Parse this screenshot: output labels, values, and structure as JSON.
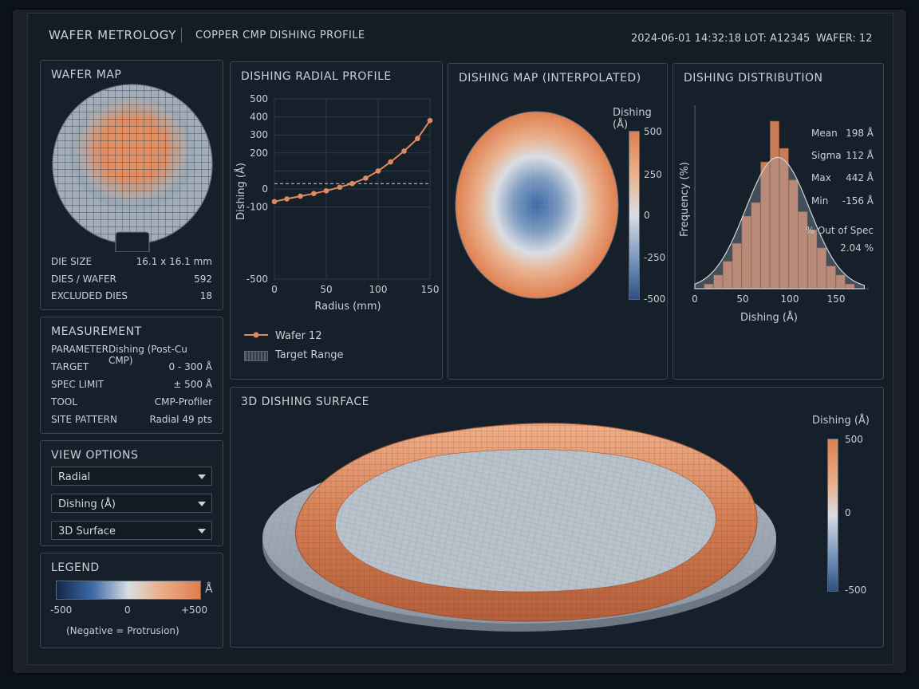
{
  "header": {
    "app_title": "WAFER METROLOGY",
    "subtitle": "COPPER CMP DISHING PROFILE",
    "datetime": "2024-06-01 14:32:18",
    "lot": "LOT: A12345",
    "wafer": "WAFER: 12"
  },
  "wafer_map": {
    "title": "WAFER MAP",
    "rows": [
      {
        "label": "DIE SIZE",
        "value": "16.1 x 16.1 mm"
      },
      {
        "label": "DIES / WAFER",
        "value": "592"
      },
      {
        "label": "EXCLUDED DIES",
        "value": "18"
      }
    ]
  },
  "measurement": {
    "title": "MEASUREMENT",
    "rows": [
      {
        "label": "PARAMETER",
        "value": "Dishing (Post-Cu CMP)"
      },
      {
        "label": "TARGET",
        "value": "0 - 300 Å"
      },
      {
        "label": "SPEC LIMIT",
        "value": "± 500 Å"
      },
      {
        "label": "TOOL",
        "value": "CMP-Profiler"
      },
      {
        "label": "SITE PATTERN",
        "value": "Radial 49 pts"
      }
    ]
  },
  "view_options": {
    "title": "VIEW OPTIONS",
    "selects": [
      "Radial",
      "Dishing (Å)",
      "3D Surface"
    ]
  },
  "legend": {
    "title": "LEGEND",
    "unit": "Å",
    "min": "-500",
    "mid": "0",
    "max": "+500",
    "note": "(Negative = Protrusion)"
  },
  "radial_profile": {
    "title": "DISHING RADIAL PROFILE",
    "legend_series": "Wafer 12",
    "legend_target": "Target Range"
  },
  "dishing_map": {
    "title": "DISHING MAP (INTERPOLATED)",
    "cbar_label": "Dishing (Å)",
    "cbar_ticks": [
      "500",
      "250",
      "0",
      "-250",
      "-500"
    ]
  },
  "distribution": {
    "title": "DISHING DISTRIBUTION",
    "stats": [
      {
        "label": "Mean",
        "value": "198 Å"
      },
      {
        "label": "Sigma",
        "value": "112 Å"
      },
      {
        "label": "Max",
        "value": "442 Å"
      },
      {
        "label": "Min",
        "value": "-156 Å"
      }
    ],
    "oos_label": "% Out of Spec",
    "oos_value": "2.04 %"
  },
  "surface3d": {
    "title": "3D DISHING SURFACE",
    "cbar_label": "Dishing (Å)",
    "cbar_ticks": [
      "500",
      "0",
      "-500"
    ]
  },
  "colors": {
    "accent": "#e08a5f",
    "cool": "#3d6aa6",
    "neutral": "#d9dde2"
  },
  "chart_data": [
    {
      "type": "line",
      "xlabel": "Radius (mm)",
      "ylabel": "Dishing (Å)",
      "xlim": [
        0,
        150
      ],
      "ylim": [
        -500,
        500
      ],
      "xticks": [
        0,
        50,
        100,
        150
      ],
      "yticks": [
        500,
        400,
        300,
        200,
        100,
        0,
        -100,
        -500
      ],
      "x_tick_labels": [
        "0",
        "50",
        "100",
        "150"
      ],
      "y_tick_labels": [
        "500",
        "400",
        "300",
        "200",
        "0",
        "-100",
        "-500"
      ],
      "target_line": 30,
      "series": [
        {
          "name": "Wafer 12",
          "x": [
            0,
            12,
            25,
            38,
            50,
            63,
            75,
            88,
            100,
            112,
            125,
            138,
            150
          ],
          "y": [
            -70,
            -55,
            -40,
            -25,
            -10,
            10,
            30,
            60,
            100,
            150,
            210,
            280,
            380
          ]
        }
      ]
    },
    {
      "type": "bar",
      "xlabel": "Dishing (Å)",
      "ylabel": "Frequency (%)",
      "x_tick_labels": [
        "0",
        "50",
        "100",
        "150"
      ],
      "bins_start": [
        -20,
        -10,
        0,
        10,
        20,
        30,
        40,
        50,
        60,
        70,
        80,
        90,
        100,
        110,
        120,
        130,
        140
      ],
      "values": [
        0,
        1,
        3,
        6,
        10,
        16,
        19,
        28,
        37,
        31,
        24,
        17,
        13,
        9,
        5,
        3,
        1
      ]
    }
  ]
}
